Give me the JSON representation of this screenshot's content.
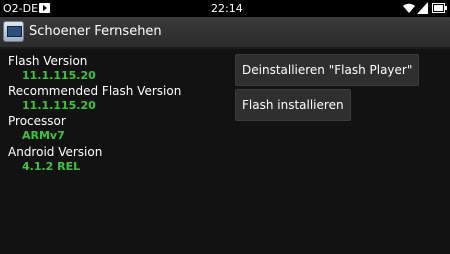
{
  "status_bar": {
    "carrier": "O2-DE",
    "time": "22:14",
    "icons": [
      "play-notification-icon",
      "wifi-icon",
      "signal-icon",
      "battery-icon"
    ]
  },
  "action_bar": {
    "title": "Schoener Fernsehen",
    "icon": "app-icon"
  },
  "info": {
    "flash_version_label": "Flash Version",
    "flash_version_value": "11.1.115.20",
    "recommended_label": "Recommended Flash Version",
    "recommended_value": "11.1.115.20",
    "processor_label": "Processor",
    "processor_value": "ARMv7",
    "android_label": "Android Version",
    "android_value": "4.1.2 REL"
  },
  "buttons": {
    "uninstall_label": "Deinstallieren \"Flash Player\"",
    "install_label": "Flash installieren"
  },
  "colors": {
    "value_green": "#3bc43b",
    "background": "#121212",
    "action_bar": "#333333"
  }
}
